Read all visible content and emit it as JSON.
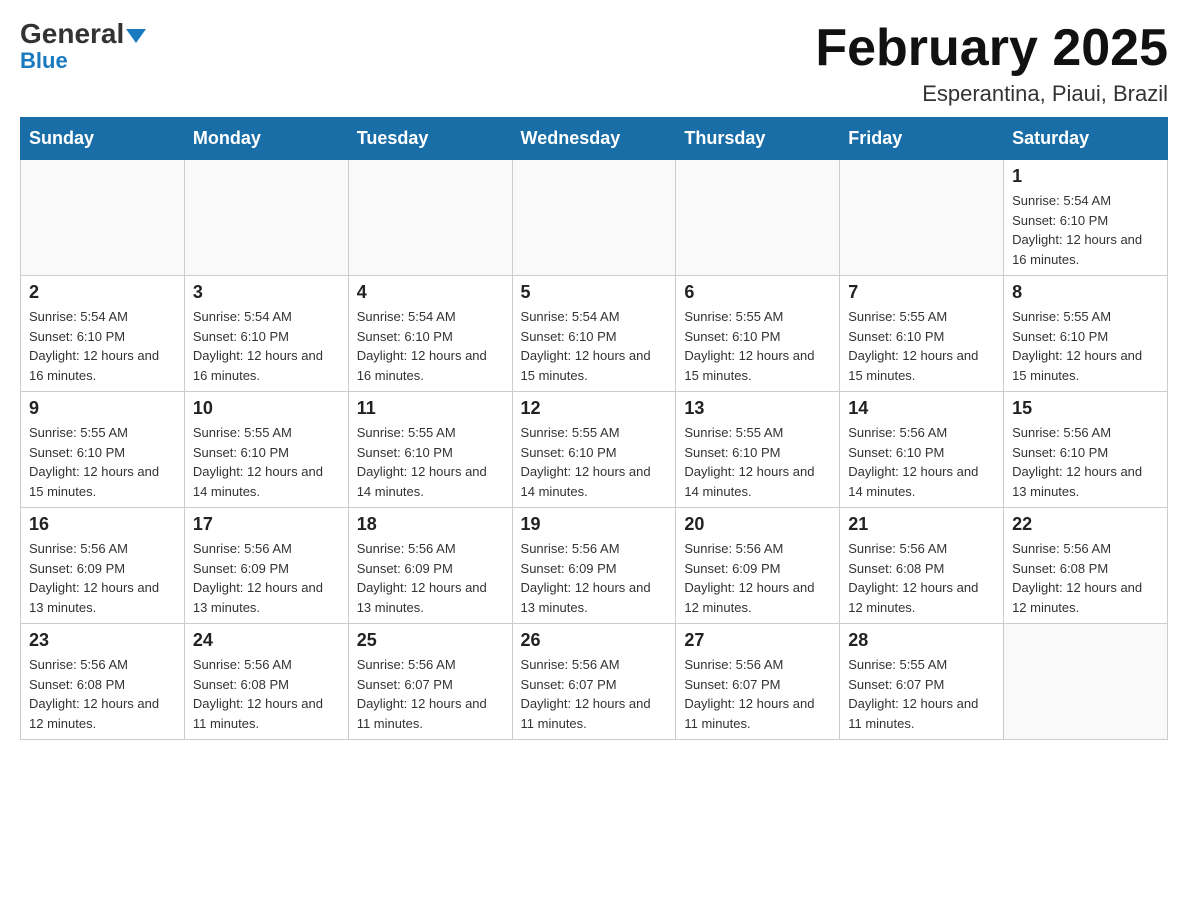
{
  "header": {
    "logo_general": "General",
    "logo_blue": "Blue",
    "title": "February 2025",
    "subtitle": "Esperantina, Piaui, Brazil"
  },
  "days_of_week": [
    "Sunday",
    "Monday",
    "Tuesday",
    "Wednesday",
    "Thursday",
    "Friday",
    "Saturday"
  ],
  "weeks": [
    [
      {
        "day": "",
        "info": ""
      },
      {
        "day": "",
        "info": ""
      },
      {
        "day": "",
        "info": ""
      },
      {
        "day": "",
        "info": ""
      },
      {
        "day": "",
        "info": ""
      },
      {
        "day": "",
        "info": ""
      },
      {
        "day": "1",
        "info": "Sunrise: 5:54 AM\nSunset: 6:10 PM\nDaylight: 12 hours and 16 minutes."
      }
    ],
    [
      {
        "day": "2",
        "info": "Sunrise: 5:54 AM\nSunset: 6:10 PM\nDaylight: 12 hours and 16 minutes."
      },
      {
        "day": "3",
        "info": "Sunrise: 5:54 AM\nSunset: 6:10 PM\nDaylight: 12 hours and 16 minutes."
      },
      {
        "day": "4",
        "info": "Sunrise: 5:54 AM\nSunset: 6:10 PM\nDaylight: 12 hours and 16 minutes."
      },
      {
        "day": "5",
        "info": "Sunrise: 5:54 AM\nSunset: 6:10 PM\nDaylight: 12 hours and 15 minutes."
      },
      {
        "day": "6",
        "info": "Sunrise: 5:55 AM\nSunset: 6:10 PM\nDaylight: 12 hours and 15 minutes."
      },
      {
        "day": "7",
        "info": "Sunrise: 5:55 AM\nSunset: 6:10 PM\nDaylight: 12 hours and 15 minutes."
      },
      {
        "day": "8",
        "info": "Sunrise: 5:55 AM\nSunset: 6:10 PM\nDaylight: 12 hours and 15 minutes."
      }
    ],
    [
      {
        "day": "9",
        "info": "Sunrise: 5:55 AM\nSunset: 6:10 PM\nDaylight: 12 hours and 15 minutes."
      },
      {
        "day": "10",
        "info": "Sunrise: 5:55 AM\nSunset: 6:10 PM\nDaylight: 12 hours and 14 minutes."
      },
      {
        "day": "11",
        "info": "Sunrise: 5:55 AM\nSunset: 6:10 PM\nDaylight: 12 hours and 14 minutes."
      },
      {
        "day": "12",
        "info": "Sunrise: 5:55 AM\nSunset: 6:10 PM\nDaylight: 12 hours and 14 minutes."
      },
      {
        "day": "13",
        "info": "Sunrise: 5:55 AM\nSunset: 6:10 PM\nDaylight: 12 hours and 14 minutes."
      },
      {
        "day": "14",
        "info": "Sunrise: 5:56 AM\nSunset: 6:10 PM\nDaylight: 12 hours and 14 minutes."
      },
      {
        "day": "15",
        "info": "Sunrise: 5:56 AM\nSunset: 6:10 PM\nDaylight: 12 hours and 13 minutes."
      }
    ],
    [
      {
        "day": "16",
        "info": "Sunrise: 5:56 AM\nSunset: 6:09 PM\nDaylight: 12 hours and 13 minutes."
      },
      {
        "day": "17",
        "info": "Sunrise: 5:56 AM\nSunset: 6:09 PM\nDaylight: 12 hours and 13 minutes."
      },
      {
        "day": "18",
        "info": "Sunrise: 5:56 AM\nSunset: 6:09 PM\nDaylight: 12 hours and 13 minutes."
      },
      {
        "day": "19",
        "info": "Sunrise: 5:56 AM\nSunset: 6:09 PM\nDaylight: 12 hours and 13 minutes."
      },
      {
        "day": "20",
        "info": "Sunrise: 5:56 AM\nSunset: 6:09 PM\nDaylight: 12 hours and 12 minutes."
      },
      {
        "day": "21",
        "info": "Sunrise: 5:56 AM\nSunset: 6:08 PM\nDaylight: 12 hours and 12 minutes."
      },
      {
        "day": "22",
        "info": "Sunrise: 5:56 AM\nSunset: 6:08 PM\nDaylight: 12 hours and 12 minutes."
      }
    ],
    [
      {
        "day": "23",
        "info": "Sunrise: 5:56 AM\nSunset: 6:08 PM\nDaylight: 12 hours and 12 minutes."
      },
      {
        "day": "24",
        "info": "Sunrise: 5:56 AM\nSunset: 6:08 PM\nDaylight: 12 hours and 11 minutes."
      },
      {
        "day": "25",
        "info": "Sunrise: 5:56 AM\nSunset: 6:07 PM\nDaylight: 12 hours and 11 minutes."
      },
      {
        "day": "26",
        "info": "Sunrise: 5:56 AM\nSunset: 6:07 PM\nDaylight: 12 hours and 11 minutes."
      },
      {
        "day": "27",
        "info": "Sunrise: 5:56 AM\nSunset: 6:07 PM\nDaylight: 12 hours and 11 minutes."
      },
      {
        "day": "28",
        "info": "Sunrise: 5:55 AM\nSunset: 6:07 PM\nDaylight: 12 hours and 11 minutes."
      },
      {
        "day": "",
        "info": ""
      }
    ]
  ]
}
